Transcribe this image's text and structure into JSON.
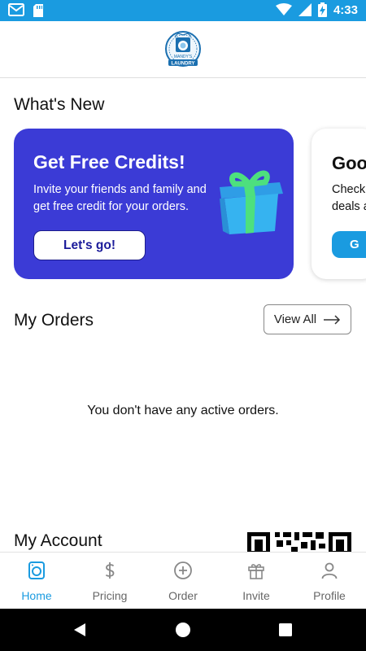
{
  "status_bar": {
    "time": "4:33"
  },
  "header": {
    "logo_top": "MANDY'S",
    "logo_bottom": "LAUNDRY"
  },
  "whats_new": {
    "title": "What's New",
    "cards": [
      {
        "title": "Get Free Credits!",
        "description": "Invite your friends and family and get free credit for your orders.",
        "button": "Let's go!",
        "color": "#3b3bd6"
      },
      {
        "title": "Goo",
        "description_lines": [
          "Check",
          "deals a"
        ],
        "button": "G",
        "color": "#1a9be0"
      }
    ]
  },
  "my_orders": {
    "title": "My Orders",
    "view_all": "View All",
    "empty_message": "You don't have any active orders."
  },
  "my_account": {
    "title": "My Account"
  },
  "tabs": [
    {
      "label": "Home",
      "icon": "washing-machine-icon",
      "active": true
    },
    {
      "label": "Pricing",
      "icon": "dollar-icon",
      "active": false
    },
    {
      "label": "Order",
      "icon": "plus-circle-icon",
      "active": false
    },
    {
      "label": "Invite",
      "icon": "gift-icon",
      "active": false
    },
    {
      "label": "Profile",
      "icon": "person-icon",
      "active": false
    }
  ],
  "colors": {
    "accent": "#1a9be0",
    "promo": "#3b3bd6"
  }
}
